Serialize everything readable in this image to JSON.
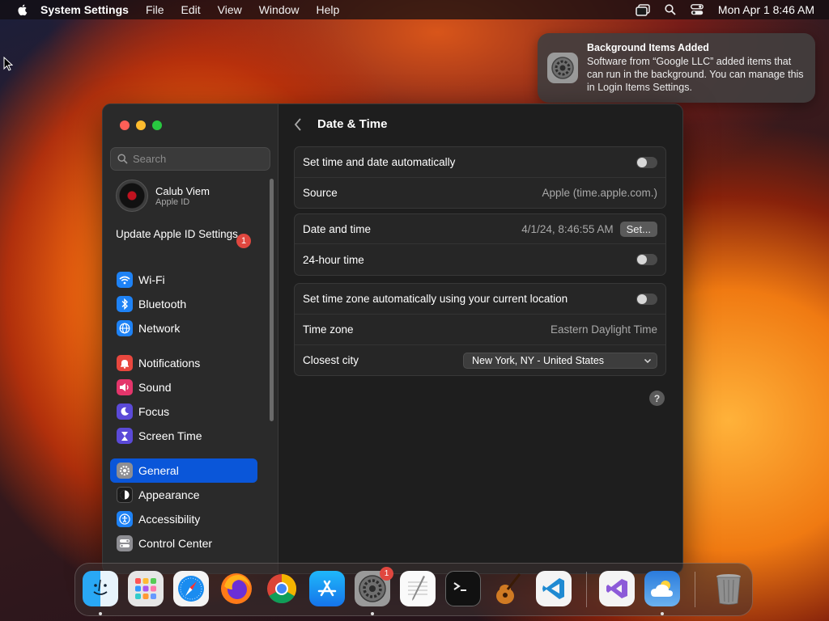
{
  "menubar": {
    "app_name": "System Settings",
    "items": [
      "File",
      "Edit",
      "View",
      "Window",
      "Help"
    ],
    "clock": "Mon Apr 1  8:46 AM"
  },
  "notification": {
    "title": "Background Items Added",
    "body": "Software from “Google LLC” added items that can run in the background. You can manage this in Login Items Settings."
  },
  "sidebar": {
    "search_placeholder": "Search",
    "account": {
      "name": "Calub Viem",
      "sub": "Apple ID"
    },
    "update": {
      "label": "Update Apple ID Settings",
      "badge": "1"
    },
    "items": [
      {
        "label": "Wi-Fi",
        "icon": "wifi-icon",
        "color": "#1e82f5"
      },
      {
        "label": "Bluetooth",
        "icon": "bluetooth-icon",
        "color": "#1e82f5"
      },
      {
        "label": "Network",
        "icon": "globe-icon",
        "color": "#1e82f5"
      },
      {
        "label": "Notifications",
        "icon": "bell-icon",
        "color": "#e8473e"
      },
      {
        "label": "Sound",
        "icon": "speaker-icon",
        "color": "#e4356b"
      },
      {
        "label": "Focus",
        "icon": "moon-icon",
        "color": "#5b4ad8"
      },
      {
        "label": "Screen Time",
        "icon": "hourglass-icon",
        "color": "#5b4ad8"
      },
      {
        "label": "General",
        "icon": "gear-icon",
        "color": "#8e8e93",
        "selected": true
      },
      {
        "label": "Appearance",
        "icon": "appearance-icon",
        "color": "#1c1c1c"
      },
      {
        "label": "Accessibility",
        "icon": "accessibility-icon",
        "color": "#1e82f5"
      },
      {
        "label": "Control Center",
        "icon": "control-center-icon",
        "color": "#8e8e93"
      }
    ]
  },
  "main": {
    "title": "Date & Time",
    "card1": {
      "auto_label": "Set time and date automatically",
      "auto_on": false,
      "source_label": "Source",
      "source_value": "Apple (time.apple.com.)"
    },
    "card2": {
      "datetime_label": "Date and time",
      "datetime_value": "4/1/24, 8:46:55 AM",
      "set_button": "Set...",
      "hour24_label": "24-hour time",
      "hour24_on": false
    },
    "card3": {
      "tz_auto_label": "Set time zone automatically using your current location",
      "tz_auto_on": false,
      "tz_label": "Time zone",
      "tz_value": "Eastern Daylight Time",
      "city_label": "Closest city",
      "city_value": "New York, NY - United States"
    },
    "help": "?"
  },
  "dock": {
    "settings_badge": "1",
    "apps": [
      {
        "name": "finder-icon"
      },
      {
        "name": "launchpad-icon"
      },
      {
        "name": "safari-icon"
      },
      {
        "name": "firefox-icon"
      },
      {
        "name": "chrome-icon"
      },
      {
        "name": "app-store-icon"
      },
      {
        "name": "system-settings-icon"
      },
      {
        "name": "textedit-icon"
      },
      {
        "name": "terminal-icon"
      },
      {
        "name": "garageband-icon"
      },
      {
        "name": "vscode-icon"
      },
      {
        "name": "visual-studio-icon"
      },
      {
        "name": "weather-icon"
      },
      {
        "name": "trash-icon"
      }
    ]
  }
}
